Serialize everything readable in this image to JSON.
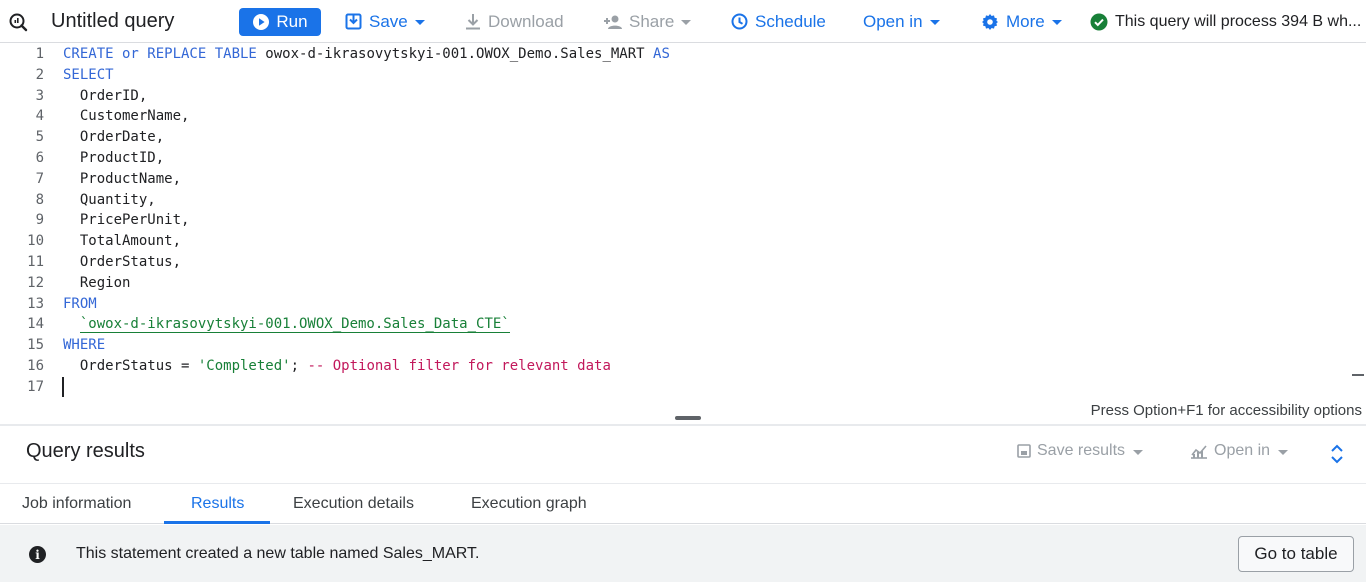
{
  "toolbar": {
    "tab_title": "Untitled query",
    "run_label": "Run",
    "save_label": "Save",
    "download_label": "Download",
    "share_label": "Share",
    "schedule_label": "Schedule",
    "open_in_label": "Open in",
    "more_label": "More",
    "validator_text": "This query will process 394 B wh..."
  },
  "editor": {
    "lines": [
      {
        "n": "1",
        "parts": [
          {
            "t": "CREATE or REPLACE TABLE",
            "c": "kw"
          },
          {
            "t": " owox-d-ikrasovytskyi-001.OWOX_Demo.Sales_MART ",
            "c": ""
          },
          {
            "t": "AS",
            "c": "kw"
          }
        ]
      },
      {
        "n": "2",
        "parts": [
          {
            "t": "SELECT",
            "c": "kw"
          }
        ]
      },
      {
        "n": "3",
        "parts": [
          {
            "t": "  OrderID,",
            "c": ""
          }
        ]
      },
      {
        "n": "4",
        "parts": [
          {
            "t": "  CustomerName,",
            "c": ""
          }
        ]
      },
      {
        "n": "5",
        "parts": [
          {
            "t": "  OrderDate,",
            "c": ""
          }
        ]
      },
      {
        "n": "6",
        "parts": [
          {
            "t": "  ProductID,",
            "c": ""
          }
        ]
      },
      {
        "n": "7",
        "parts": [
          {
            "t": "  ProductName,",
            "c": ""
          }
        ]
      },
      {
        "n": "8",
        "parts": [
          {
            "t": "  Quantity,",
            "c": ""
          }
        ]
      },
      {
        "n": "9",
        "parts": [
          {
            "t": "  PricePerUnit,",
            "c": ""
          }
        ]
      },
      {
        "n": "10",
        "parts": [
          {
            "t": "  TotalAmount,",
            "c": ""
          }
        ]
      },
      {
        "n": "11",
        "parts": [
          {
            "t": "  OrderStatus,",
            "c": ""
          }
        ]
      },
      {
        "n": "12",
        "parts": [
          {
            "t": "  Region",
            "c": ""
          }
        ]
      },
      {
        "n": "13",
        "parts": [
          {
            "t": "FROM",
            "c": "kw"
          }
        ]
      },
      {
        "n": "14",
        "parts": [
          {
            "t": "  ",
            "c": ""
          },
          {
            "t": "`owox-d-ikrasovytskyi-001.OWOX_Demo.Sales_Data_CTE`",
            "c": "tblref"
          }
        ]
      },
      {
        "n": "15",
        "parts": [
          {
            "t": "WHERE",
            "c": "kw"
          }
        ]
      },
      {
        "n": "16",
        "parts": [
          {
            "t": "  OrderStatus = ",
            "c": ""
          },
          {
            "t": "'Completed'",
            "c": "str"
          },
          {
            "t": "; ",
            "c": ""
          },
          {
            "t": "-- Optional filter for relevant data",
            "c": "cmt"
          }
        ]
      },
      {
        "n": "17",
        "parts": []
      }
    ],
    "accessibility_hint": "Press Option+F1 for accessibility options"
  },
  "results": {
    "title": "Query results",
    "save_results_label": "Save results",
    "open_in_label": "Open in",
    "tabs": [
      {
        "label": "Job information",
        "active": false
      },
      {
        "label": "Results",
        "active": true
      },
      {
        "label": "Execution details",
        "active": false
      },
      {
        "label": "Execution graph",
        "active": false
      }
    ],
    "info_message": "This statement created a new table named Sales_MART.",
    "go_to_table_label": "Go to table"
  },
  "colors": {
    "accent": "#1a73e8",
    "keyword": "#3367d6",
    "string": "#188038",
    "comment": "#c2185b",
    "success": "#188038"
  }
}
